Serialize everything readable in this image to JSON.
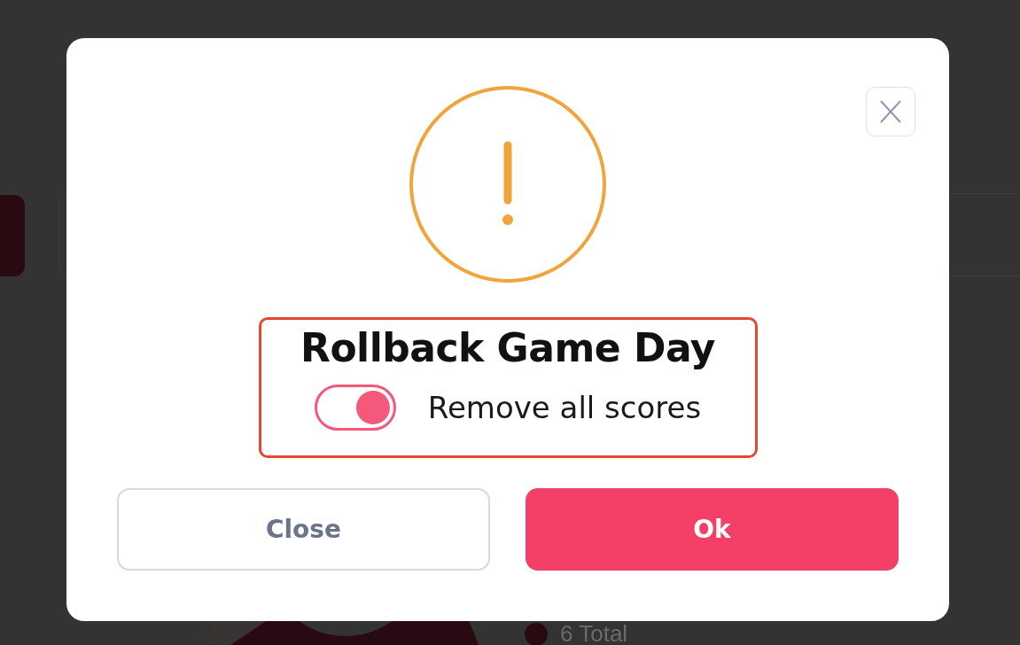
{
  "background": {
    "legend": [
      {
        "label": "6 Total",
        "color": "#2a0a12"
      }
    ]
  },
  "dialog": {
    "title": "Rollback Game Day",
    "option": {
      "label": "Remove all scores",
      "on": true,
      "highlighted": true
    },
    "buttons": [
      {
        "label": "Close",
        "kind": "secondary"
      },
      {
        "label": "Ok",
        "kind": "primary"
      }
    ]
  }
}
